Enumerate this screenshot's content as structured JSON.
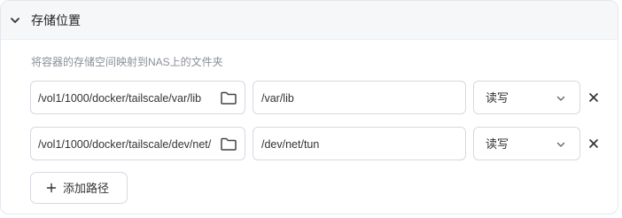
{
  "section": {
    "title": "存储位置",
    "collapse_icon": "chevron-down-icon"
  },
  "description": "将容器的存储空间映射到NAS上的文件夹",
  "mappings": [
    {
      "host_path": "/vol1/1000/docker/tailscale/var/lib",
      "container_path": "/var/lib",
      "mode": "读写"
    },
    {
      "host_path": "/vol1/1000/docker/tailscale/dev/net/",
      "container_path": "/dev/net/tun",
      "mode": "读写"
    }
  ],
  "icons": {
    "browse": "folder-icon",
    "dropdown": "chevron-down-icon",
    "remove": "close-icon",
    "add": "plus-icon"
  },
  "add_button_label": "添加路径",
  "colors": {
    "header_bg": "#f6f7f9",
    "border": "#d5d9e0",
    "description_text": "#8a8f99"
  }
}
